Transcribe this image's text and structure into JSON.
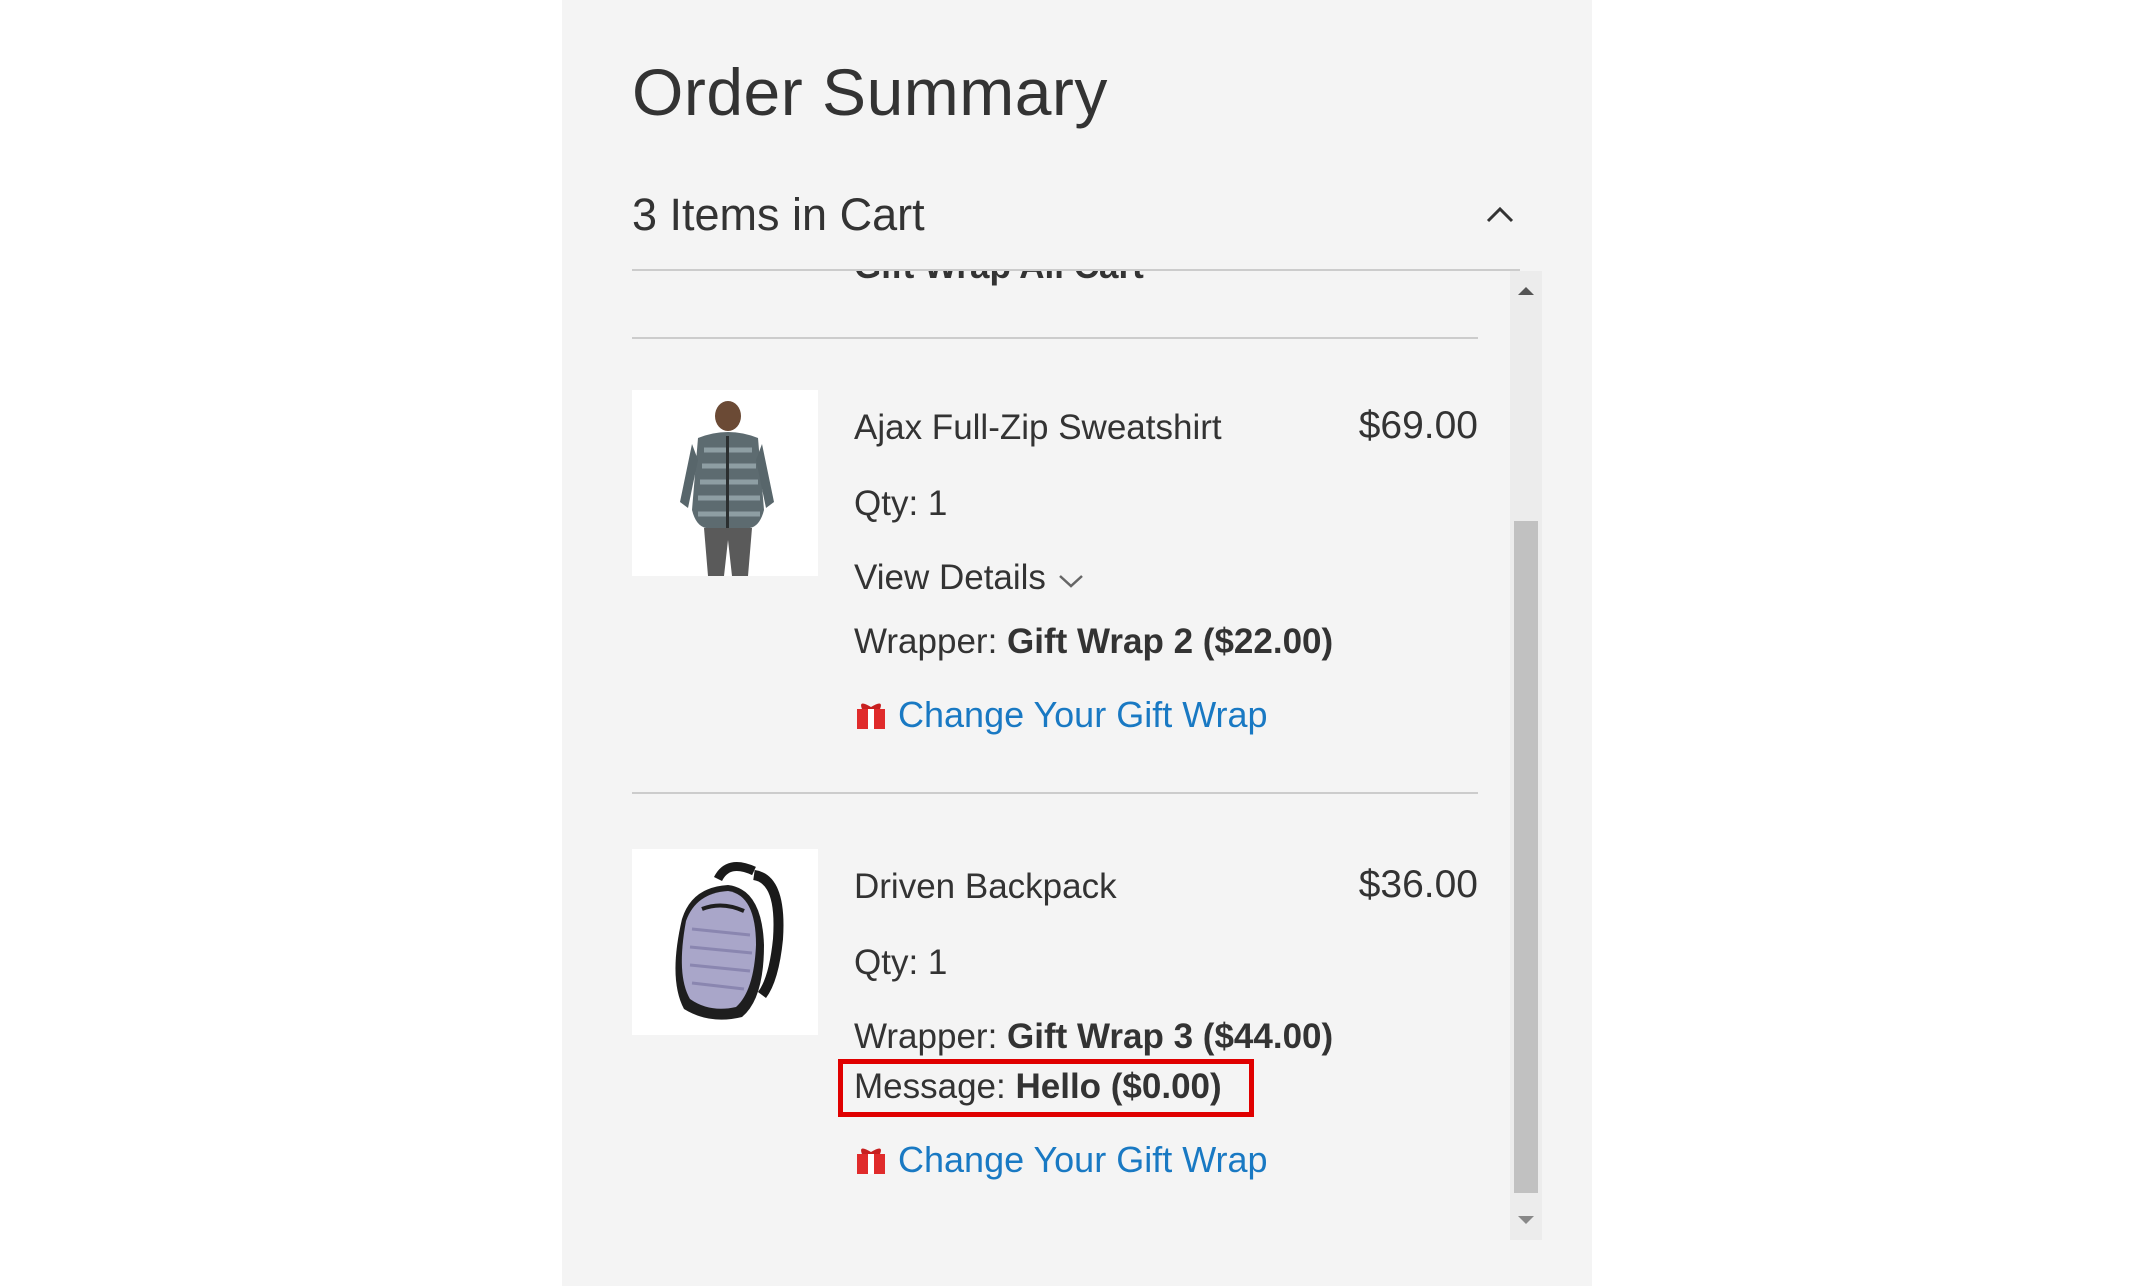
{
  "summary": {
    "title": "Order Summary",
    "cart_count": "3 Items in Cart",
    "partially_hidden_text": "Gift Wrap All Cart"
  },
  "items": [
    {
      "name": "Ajax Full-Zip Sweatshirt",
      "price": "$69.00",
      "qty": "Qty: 1",
      "view_details": "View Details",
      "wrapper_label": "Wrapper:",
      "wrapper_value": "Gift Wrap 2 ($22.00)",
      "gift_link": "Change Your Gift Wrap",
      "image_icon": "sweatshirt-photo"
    },
    {
      "name": "Driven Backpack",
      "price": "$36.00",
      "qty": "Qty: 1",
      "wrapper_label": "Wrapper:",
      "wrapper_value": "Gift Wrap 3 ($44.00)",
      "message_label": "Message:",
      "message_value": "Hello ($0.00)",
      "gift_link": "Change Your Gift Wrap",
      "image_icon": "backpack-photo"
    }
  ],
  "colors": {
    "panel_bg": "#f4f4f4",
    "link": "#1979c3",
    "highlight": "#e00000",
    "gift_icon": "#e02b2b"
  },
  "icons": {
    "collapse": "chevron-up-icon",
    "expand_details": "chevron-down-icon",
    "gift": "gift-icon"
  }
}
